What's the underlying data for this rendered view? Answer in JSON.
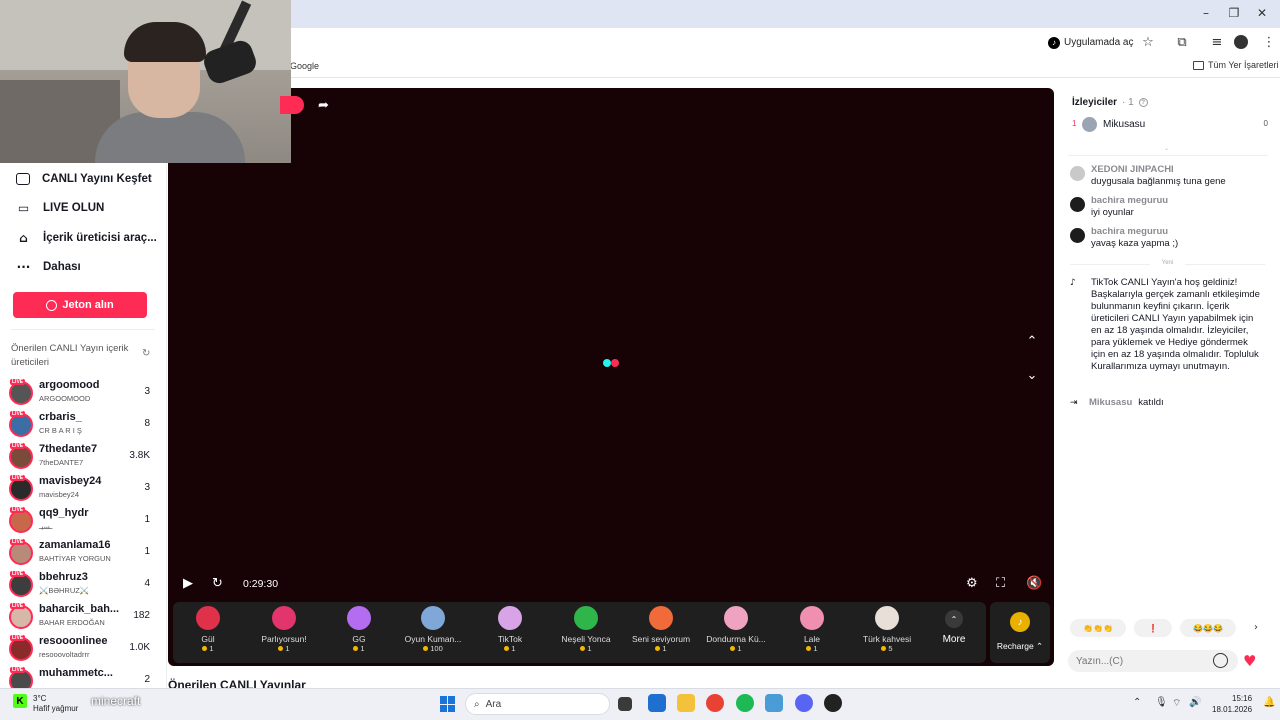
{
  "browser": {
    "open_app_label": "Uygulamada aç",
    "bookmark_google": "Google",
    "bookmark_all": "Tüm Yer İşaretleri"
  },
  "sidebar": {
    "nav": [
      {
        "label": "CANLI Yayını Keşfet",
        "icon": "live-tv-icon"
      },
      {
        "label": "LIVE OLUN",
        "icon": "video-camera-icon"
      },
      {
        "label": "İçerik üreticisi araç...",
        "icon": "creator-tools-icon"
      },
      {
        "label": "Dahası",
        "icon": "more-dots-icon"
      }
    ],
    "coins_button": "Jeton alın",
    "suggested_title": "Önerilen CANLI Yayın içerik üreticileri",
    "live_badge": "LIVE",
    "creators": [
      {
        "name": "argoomood",
        "sub": "ARGOOMOOD",
        "count": "3"
      },
      {
        "name": "crbaris_",
        "sub": "CR B A R I Ş",
        "count": "8"
      },
      {
        "name": "7thedante7",
        "sub": "7theDANTE7",
        "count": "3.8K"
      },
      {
        "name": "mavisbey24",
        "sub": "mavisbey24",
        "count": "3"
      },
      {
        "name": "qq9_hydr",
        "sub": "ـسيـ",
        "count": "1"
      },
      {
        "name": "zamanlama16",
        "sub": "BAHTİYAR YORGUN",
        "count": "1"
      },
      {
        "name": "bbehruz3",
        "sub": "⚔️BƏHRUZ⚔️",
        "count": "4"
      },
      {
        "name": "baharcik_bah...",
        "sub": "BAHAR ERDOĞAN",
        "count": "182"
      },
      {
        "name": "resooonlinee",
        "sub": "resooovoltadrrr",
        "count": "1.0K"
      },
      {
        "name": "muhammetc...",
        "sub": "",
        "count": "2"
      }
    ]
  },
  "player": {
    "time": "0:29:30",
    "section_title": "Önerilen CANLI Yayınlar"
  },
  "gifts": [
    {
      "name": "Gül",
      "price": "1",
      "color": "#e0314b"
    },
    {
      "name": "Parlıyorsun!",
      "price": "1",
      "color": "#e2356b"
    },
    {
      "name": "GG",
      "price": "1",
      "color": "#b46cf0"
    },
    {
      "name": "Oyun Kuman...",
      "price": "100",
      "color": "#7fa8d8"
    },
    {
      "name": "TikTok",
      "price": "1",
      "color": "#d9a3e8"
    },
    {
      "name": "Neşeli Yonca",
      "price": "1",
      "color": "#2fb54a"
    },
    {
      "name": "Seni seviyorum",
      "price": "1",
      "color": "#f06a3a"
    },
    {
      "name": "Dondurma Kü...",
      "price": "1",
      "color": "#f0a3c0"
    },
    {
      "name": "Lale",
      "price": "1",
      "color": "#f08fb0"
    },
    {
      "name": "Türk kahvesi",
      "price": "5",
      "color": "#e8e0d8"
    }
  ],
  "gift_more": "More",
  "gift_recharge": "Recharge ⌃",
  "viewers": {
    "title": "İzleyiciler",
    "count": "· 1",
    "list": [
      {
        "rank": "1",
        "name": "Mikusasu",
        "score": "0"
      }
    ]
  },
  "chat": {
    "messages": [
      {
        "user": "XEDONI JINPACHI",
        "text": "duygusala bağlanmış tuna gene"
      },
      {
        "user": "bachira meguruu",
        "text": "iyi oyunlar"
      },
      {
        "user": "bachira meguruu",
        "text": "yavaş kaza yapma ;)"
      }
    ],
    "new_label": "Yeni",
    "welcome": "TikTok CANLI Yayın'a hoş geldiniz! Başkalarıyla gerçek zamanlı etkileşimde bulunmanın keyfini çıkarın. İçerik üreticileri CANLI Yayın yapabilmek için en az 18 yaşında olmalıdır. İzleyiciler, para yüklemek ve Hediye göndermek için en az 18 yaşında olmalıdır. Topluluk Kurallarımıza uymayı unutmayın.",
    "joined_user": "Mikusasu",
    "joined_text": "katıldı",
    "quick_reactions": [
      "👏👏👏",
      "❗",
      "😂😂😂"
    ],
    "input_placeholder": "Yazın...(C)"
  },
  "taskbar": {
    "weather_temp": "3°C",
    "weather_desc": "Hafif yağmur",
    "overlay_text": "minecraft",
    "search_label": "Ara",
    "time": "15:16",
    "date": "18.01.2026"
  },
  "colors": {
    "accent": "#fe2c55",
    "player_bg": "#170206",
    "loader_cyan": "#25f4ee",
    "loader_pink": "#fe2c55"
  }
}
